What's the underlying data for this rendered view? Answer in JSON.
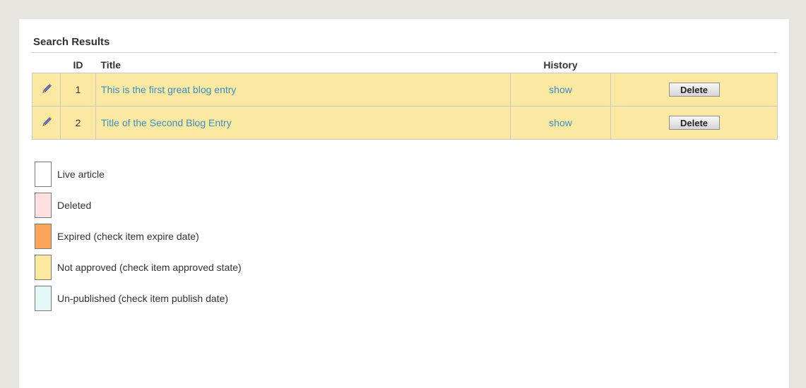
{
  "results": {
    "heading": "Search Results",
    "columns": {
      "id": "ID",
      "title": "Title",
      "history": "History"
    },
    "rows": [
      {
        "id": "1",
        "title": "This is the first great blog entry",
        "history": "show",
        "delete_label": "Delete",
        "status_color": "#fbe8a1"
      },
      {
        "id": "2",
        "title": "Title of the Second Blog Entry",
        "history": "show",
        "delete_label": "Delete",
        "status_color": "#fbe8a1"
      }
    ]
  },
  "legend": [
    {
      "label": "Live article",
      "color": "#ffffff"
    },
    {
      "label": "Deleted",
      "color": "#fde0df"
    },
    {
      "label": "Expired (check item expire date)",
      "color": "#f9a65a"
    },
    {
      "label": "Not approved (check item approved state)",
      "color": "#fbe8a1"
    },
    {
      "label": "Un-published (check item publish date)",
      "color": "#e2f9f8"
    }
  ],
  "icons": {
    "edit": "pencil-icon"
  }
}
